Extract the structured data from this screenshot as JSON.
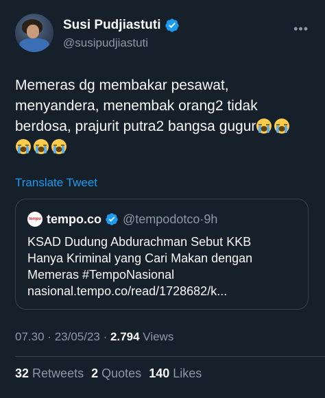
{
  "author": {
    "name": "Susi Pudjiastuti",
    "handle": "@susipudjiastuti"
  },
  "tweet": {
    "text": "Memeras dg membakar pesawat, menyandera, menembak orang2 tidak berdosa, prajurit putra2 bangsa gugur",
    "emojis": [
      "loudly-crying-face",
      "loudly-crying-face",
      "loudly-crying-face",
      "loudly-crying-face",
      "loudly-crying-face"
    ],
    "translate_label": "Translate Tweet"
  },
  "quote": {
    "logo_text": "tempo",
    "name": "tempo.co",
    "handle": "@tempodotco",
    "separator": "·",
    "time": "9h",
    "text_line1": "KSAD Dudung Abdurachman Sebut KKB",
    "text_line2": "Hanya Kriminal yang Cari Makan dengan",
    "text_line3": "Memeras #TempoNasional",
    "text_line4": "nasional.tempo.co/read/1728682/k..."
  },
  "meta": {
    "time": "07.30",
    "sep1": "·",
    "date": "23/05/23",
    "sep2": "·",
    "views_count": "2.794",
    "views_label": "Views"
  },
  "stats": {
    "retweets_count": "32",
    "retweets_label": "Retweets",
    "quotes_count": "2",
    "quotes_label": "Quotes",
    "likes_count": "140",
    "likes_label": "Likes"
  },
  "colors": {
    "background": "#15202b",
    "accent": "#1d9bf0",
    "muted": "#8b98a5",
    "border": "#38444d"
  }
}
